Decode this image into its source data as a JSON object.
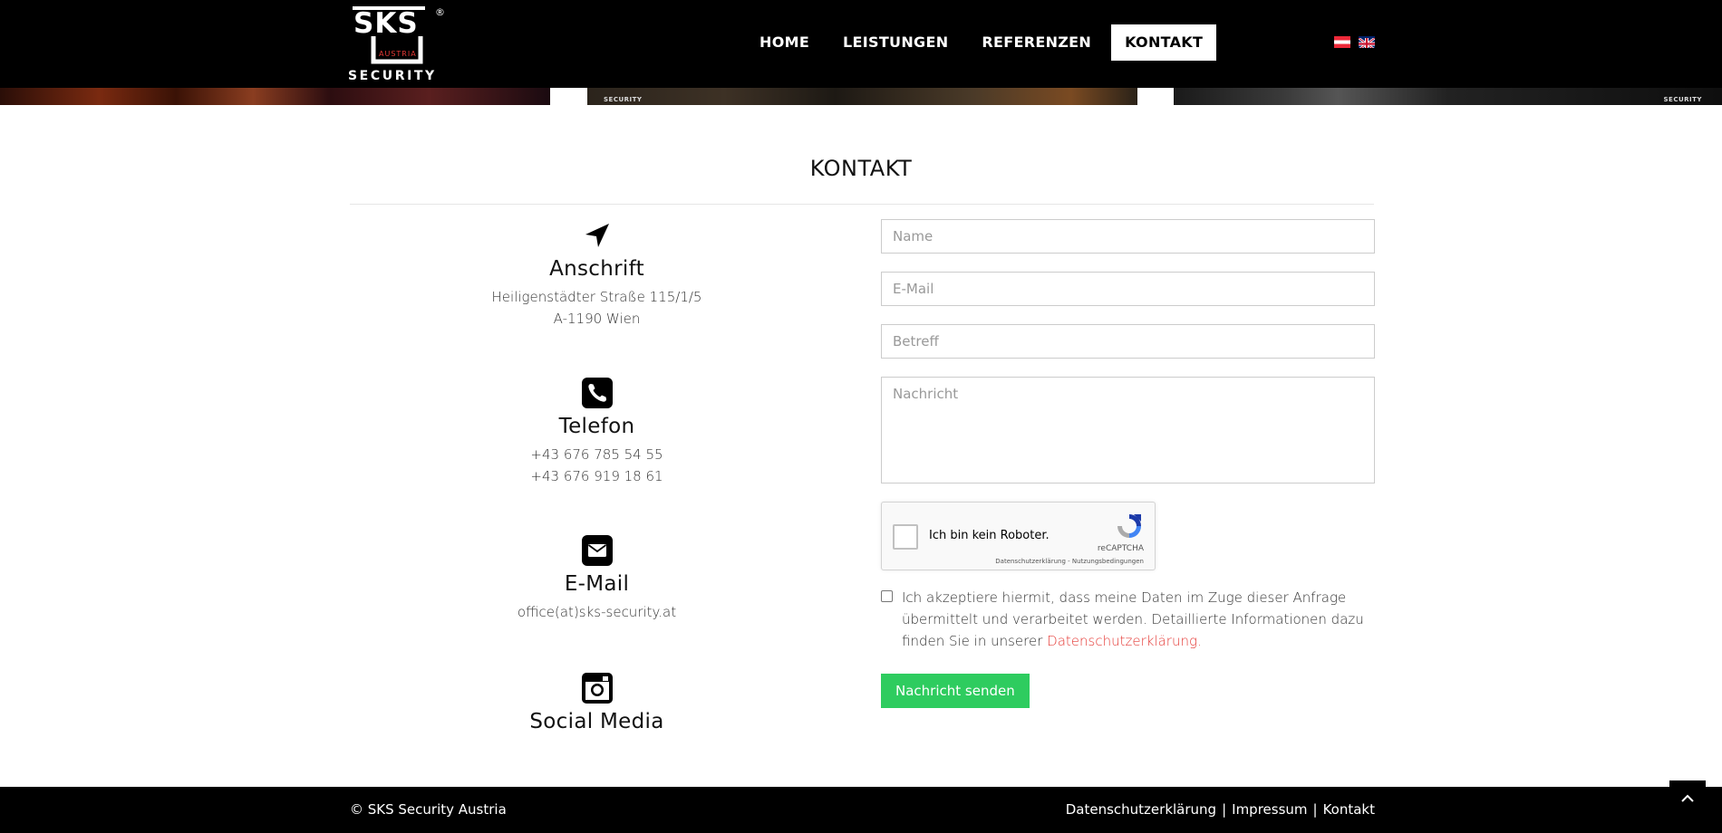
{
  "header": {
    "logo": {
      "brand": "SKS",
      "country": "AUSTRIA",
      "word": "SECURITY",
      "registered": "®"
    },
    "nav": [
      {
        "label": "HOME",
        "active": false
      },
      {
        "label": "LEISTUNGEN",
        "active": false
      },
      {
        "label": "REFERENZEN",
        "active": false
      },
      {
        "label": "KONTAKT",
        "active": true
      }
    ],
    "languages": [
      "flag-austria-icon",
      "flag-uk-icon"
    ]
  },
  "hero_strip": {
    "panel_tag": "SECURITY"
  },
  "main": {
    "title": "KONTAKT",
    "contact": {
      "address": {
        "icon": "location-arrow-icon",
        "heading": "Anschrift",
        "lines": [
          "Heiligenstädter Straße 115/1/5",
          "A-1190 Wien"
        ]
      },
      "phone": {
        "icon": "phone-icon",
        "heading": "Telefon",
        "lines": [
          "+43 676 785 54 55",
          "+43 676 919 18 61"
        ]
      },
      "email": {
        "icon": "envelope-icon",
        "heading": "E-Mail",
        "lines": [
          "office(at)sks-security.at"
        ]
      },
      "social": {
        "icon": "instagram-icon",
        "heading": "Social Media"
      }
    },
    "form": {
      "name_placeholder": "Name",
      "email_placeholder": "E-Mail",
      "subject_placeholder": "Betreff",
      "message_placeholder": "Nachricht",
      "recaptcha": {
        "label": "Ich bin kein Roboter.",
        "brand": "reCAPTCHA",
        "links": "Datenschutzerklärung - Nutzungsbedingungen"
      },
      "consent": {
        "text": "Ich akzeptiere hiermit, dass meine Daten im Zuge dieser Anfrage übermittelt und verarbeitet werden. Detaillierte Informationen dazu finden Sie in unserer ",
        "link": "Datenschutzerklärung",
        "suffix": "."
      },
      "submit_label": "Nachricht senden"
    }
  },
  "footer": {
    "copyright": "© SKS Security Austria",
    "links": [
      "Datenschutzerklärung",
      "Impressum",
      "Kontakt"
    ],
    "separator": "|"
  },
  "colors": {
    "header_bg": "#000000",
    "submit_bg": "#2ecc5f",
    "link_red": "#e53935"
  }
}
